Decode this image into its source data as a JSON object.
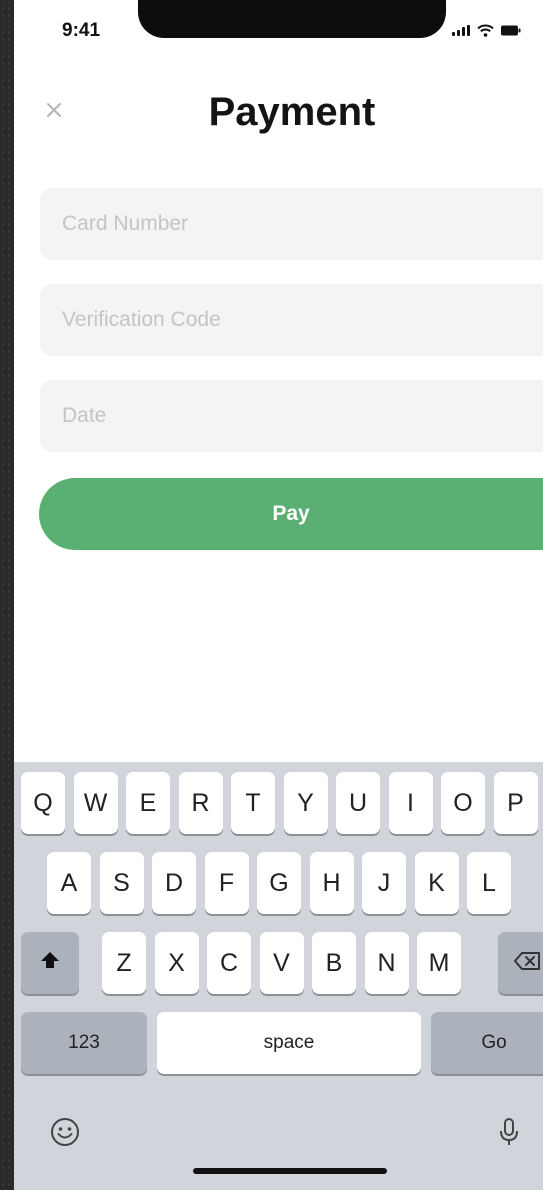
{
  "status_bar": {
    "time": "9:41"
  },
  "header": {
    "title": "Payment",
    "close_icon": "close-icon"
  },
  "form": {
    "card_number_placeholder": "Card Number",
    "verification_code_placeholder": "Verification Code",
    "date_placeholder": "Date",
    "card_number_value": "",
    "verification_code_value": "",
    "date_value": ""
  },
  "pay_button": {
    "label": "Pay"
  },
  "keyboard": {
    "row1": [
      "Q",
      "W",
      "E",
      "R",
      "T",
      "Y",
      "U",
      "I",
      "O",
      "P"
    ],
    "row2": [
      "A",
      "S",
      "D",
      "F",
      "G",
      "H",
      "J",
      "K",
      "L"
    ],
    "row3": [
      "Z",
      "X",
      "C",
      "V",
      "B",
      "N",
      "M"
    ],
    "numbers_label": "123",
    "space_label": "space",
    "go_label": "Go"
  },
  "colors": {
    "accent": "#5aaf72",
    "field_background": "#f4f4f4",
    "keyboard_background": "#d1d4da"
  }
}
